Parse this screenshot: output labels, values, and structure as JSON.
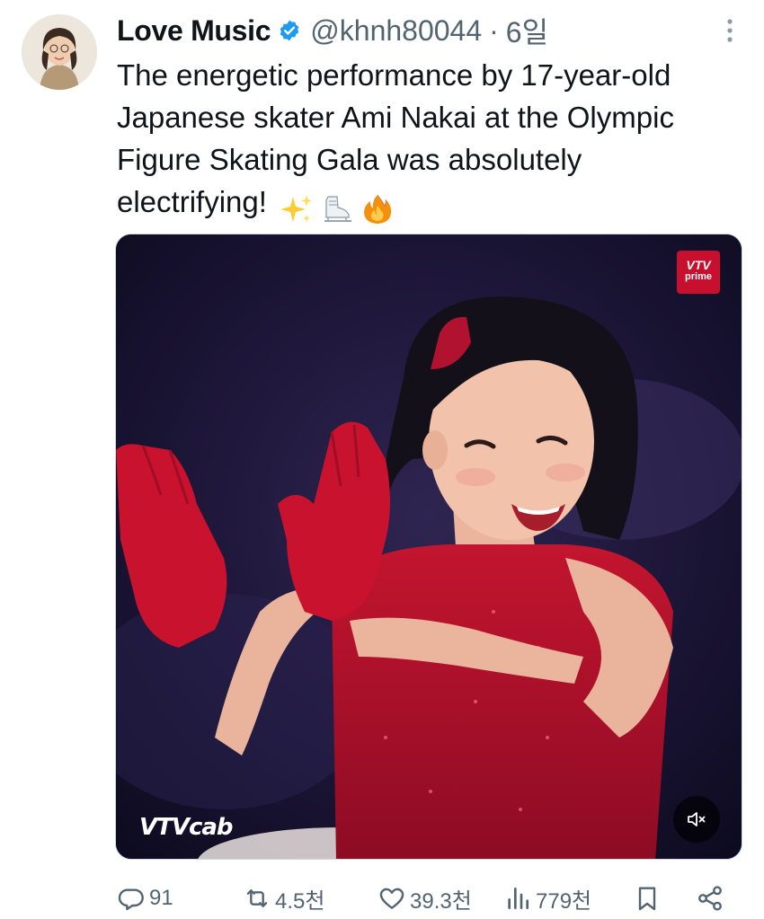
{
  "author": {
    "name": "Love Music",
    "handle": "@khnh80044",
    "separator": "·",
    "time": "6일"
  },
  "tweet": {
    "text": "The energetic performance by 17-year-old Japanese skater Ami Nakai at the Olympic Figure Skating Gala was absolutely electrifying!",
    "emojis": [
      "sparkles-icon",
      "ice-skate-icon",
      "fire-icon"
    ]
  },
  "media": {
    "broadcaster_badge_top": "VTV",
    "broadcaster_badge_bottom": "prime",
    "watermark": "VTVcab",
    "mute_icon": "speaker-muted-icon"
  },
  "actions": {
    "replies": "91",
    "retweets": "4.5천",
    "likes": "39.3천",
    "views": "779천"
  },
  "colors": {
    "verified": "#1d9bf0",
    "muted_text": "#536471",
    "primary_text": "#0f1419",
    "costume_red": "#b0122f"
  }
}
